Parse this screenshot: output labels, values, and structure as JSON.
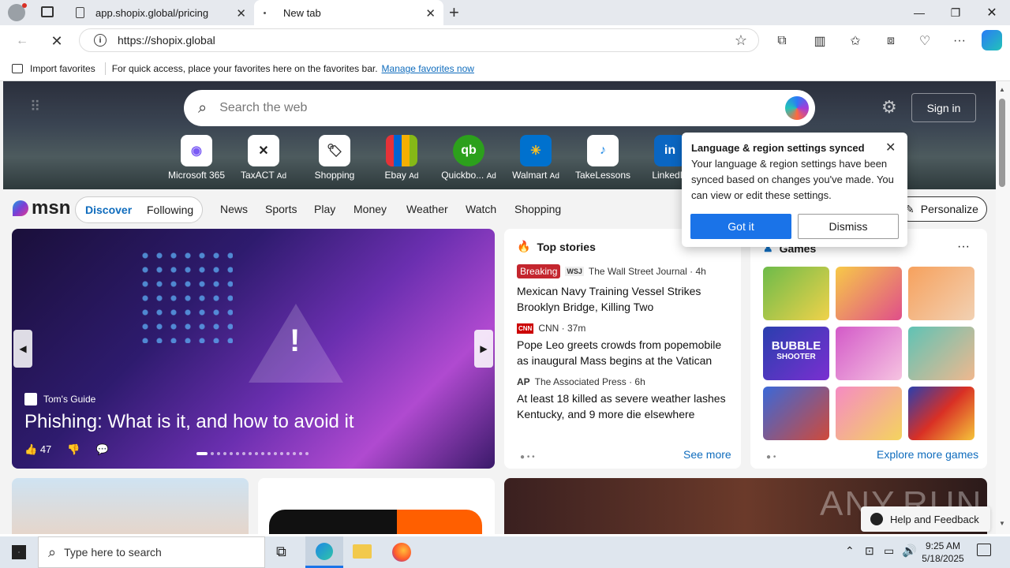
{
  "browser": {
    "tabs": [
      {
        "title": "app.shopix.global/pricing"
      },
      {
        "title": "New tab"
      }
    ],
    "address": "https://shopix.global",
    "favorites_bar": {
      "import_label": "Import favorites",
      "hint": "For quick access, place your favorites here on the favorites bar.",
      "manage_link": "Manage favorites now"
    }
  },
  "page": {
    "search_placeholder": "Search the web",
    "signin_label": "Sign in",
    "quick_links": [
      {
        "label": "Microsoft 365",
        "ad": ""
      },
      {
        "label": "TaxACT",
        "ad": "Ad"
      },
      {
        "label": "Shopping",
        "ad": ""
      },
      {
        "label": "Ebay",
        "ad": "Ad"
      },
      {
        "label": "Quickbo...",
        "ad": "Ad"
      },
      {
        "label": "Walmart",
        "ad": "Ad"
      },
      {
        "label": "TakeLessons",
        "ad": ""
      },
      {
        "label": "LinkedIn",
        "ad": ""
      }
    ],
    "msn_logo": "msn",
    "feed_tabs": [
      "Discover",
      "Following"
    ],
    "nav_items": [
      "News",
      "Sports",
      "Play",
      "Money",
      "Weather",
      "Watch",
      "Shopping"
    ],
    "personalize_label": "Personalize",
    "hero": {
      "source": "Tom's Guide",
      "headline": "Phishing: What is it, and how to avoid it",
      "likes": "47"
    },
    "top_stories": {
      "title": "Top stories",
      "breaking_badge": "Breaking",
      "items": [
        {
          "source": "The Wall Street Journal · 4h",
          "headline": "Mexican Navy Training Vessel Strikes Brooklyn Bridge, Killing Two"
        },
        {
          "source": "CNN · 37m",
          "headline": "Pope Leo greets crowds from popemobile as inaugural Mass begins at the Vatican"
        },
        {
          "source": "The Associated Press · 6h",
          "headline": "At least 18 killed as severe weather lashes Kentucky, and 9 more die elsewhere"
        }
      ],
      "see_more": "See more"
    },
    "games": {
      "title": "Games",
      "explore": "Explore more games",
      "thumb_text": {
        "bubble_line1": "BUBBLE",
        "bubble_line2": "SHOOTER"
      }
    },
    "popup": {
      "title": "Language & region settings synced",
      "body": "Your language & region settings have been synced based on changes you've made. You can view or edit these settings.",
      "got_it": "Got it",
      "dismiss": "Dismiss"
    },
    "help_feedback": "Help and Feedback",
    "watermark": "ANY.RUN"
  },
  "taskbar": {
    "search_placeholder": "Type here to search",
    "time": "9:25 AM",
    "date": "5/18/2025"
  },
  "colors": {
    "accent": "#0f6cbd",
    "got_it_bg": "#1a73e8",
    "breaking": "#c4262e"
  }
}
